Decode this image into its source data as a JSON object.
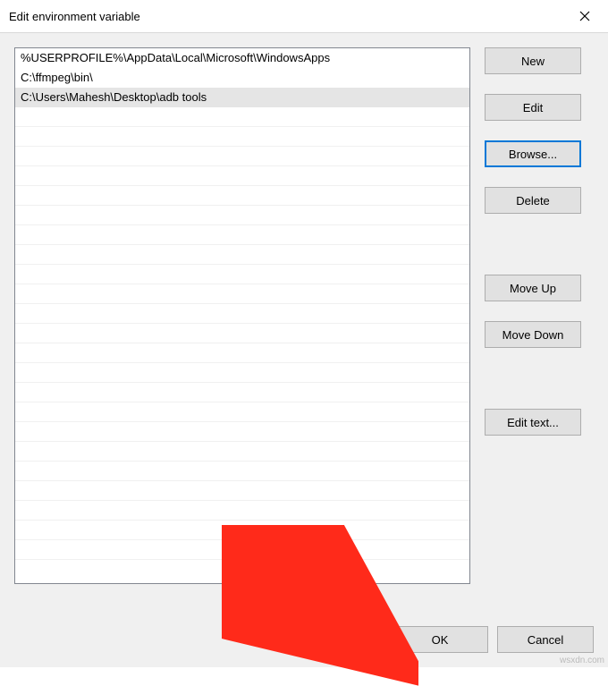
{
  "title": "Edit environment variable",
  "list": {
    "items": [
      {
        "text": "%USERPROFILE%\\AppData\\Local\\Microsoft\\WindowsApps",
        "selected": false
      },
      {
        "text": "C:\\ffmpeg\\bin\\",
        "selected": false
      },
      {
        "text": "C:\\Users\\Mahesh\\Desktop\\adb tools",
        "selected": true
      }
    ]
  },
  "buttons": {
    "new": "New",
    "edit": "Edit",
    "browse": "Browse...",
    "delete": "Delete",
    "moveUp": "Move Up",
    "moveDown": "Move Down",
    "editText": "Edit text...",
    "ok": "OK",
    "cancel": "Cancel"
  },
  "watermark": "wsxdn.com"
}
